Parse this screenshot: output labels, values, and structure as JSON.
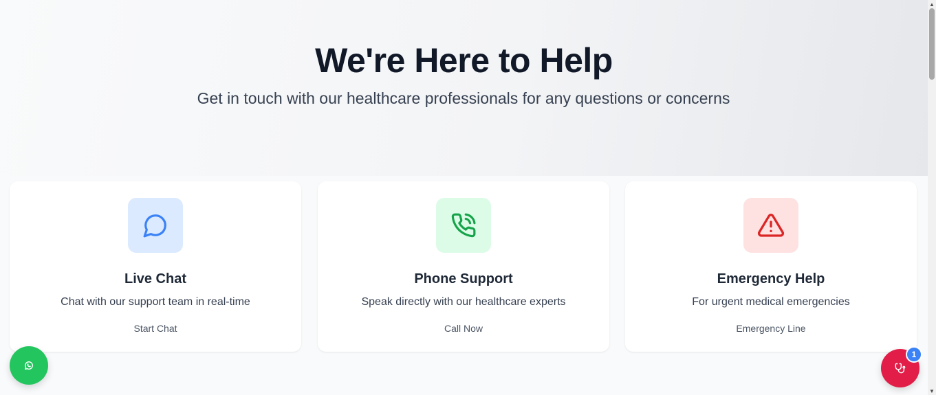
{
  "hero": {
    "title": "We're Here to Help",
    "subtitle": "Get in touch with our healthcare professionals for any questions or concerns"
  },
  "cards": [
    {
      "title": "Live Chat",
      "description": "Chat with our support team in real-time",
      "action": "Start Chat",
      "icon": "chat-bubble-icon",
      "icon_color": "#3b82f6",
      "icon_bg": "#dbeafe"
    },
    {
      "title": "Phone Support",
      "description": "Speak directly with our healthcare experts",
      "action": "Call Now",
      "icon": "phone-call-icon",
      "icon_color": "#16a34a",
      "icon_bg": "#dcfce7"
    },
    {
      "title": "Emergency Help",
      "description": "For urgent medical emergencies",
      "action": "Emergency Line",
      "icon": "alert-triangle-icon",
      "icon_color": "#dc2626",
      "icon_bg": "#fee2e2"
    }
  ],
  "floating": {
    "whatsapp": {
      "icon": "whatsapp-icon",
      "color": "#22c55e"
    },
    "doctor": {
      "icon": "stethoscope-icon",
      "color": "#e11d48",
      "badge": "1",
      "badge_color": "#3b82f6"
    }
  }
}
